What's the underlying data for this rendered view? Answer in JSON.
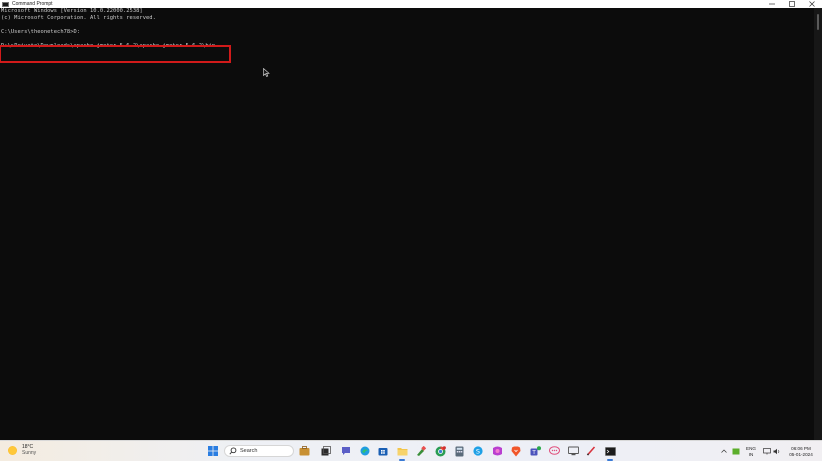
{
  "window": {
    "title": "Command Prompt"
  },
  "console": {
    "lines": [
      "Microsoft Windows [Version 10.0.22000.2538]",
      "(c) Microsoft Corporation. All rights reserved.",
      "",
      "C:\\Users\\theonetech78>D:",
      "",
      "D:\\>Private\\Downloads\\apache-jmeter-5.6.2\\apache-jmeter-5.6.2\\bin"
    ],
    "highlight_color": "#d11a1a",
    "text_color": "#cccccc",
    "background_color": "#0c0c0c"
  },
  "taskbar": {
    "weather": {
      "temp": "18°C",
      "condition": "Sunny",
      "icon": "sun-icon"
    },
    "search": {
      "label": "Search",
      "icon": "search-icon"
    },
    "apps": [
      "windows-start-icon",
      "search-icon",
      "briefcase-icon",
      "task-view-icon",
      "chat-icon",
      "edge-icon",
      "store-icon",
      "file-explorer-icon",
      "paint-icon",
      "chrome-icon",
      "calculator-icon",
      "skype-icon",
      "photos-icon",
      "brave-icon",
      "teams-icon",
      "feedback-icon",
      "remote-desktop-icon",
      "pen-icon",
      "command-prompt-icon"
    ],
    "tray": {
      "language_line1": "ENG",
      "language_line2": "IN",
      "time": "06:06 PM",
      "date": "05-01-2024"
    }
  }
}
